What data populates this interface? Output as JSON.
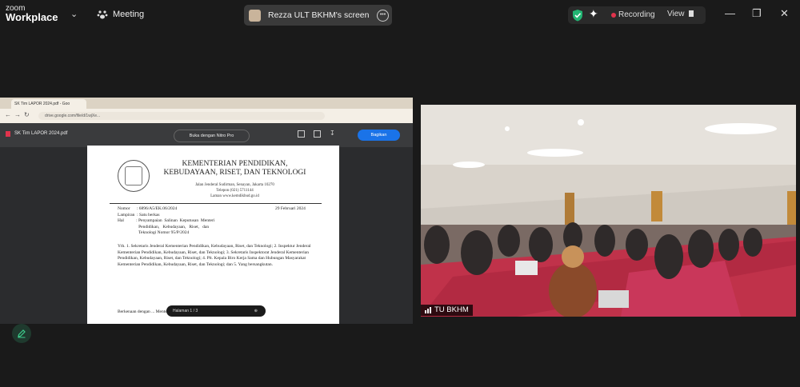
{
  "topbar": {
    "logo_line1": "zoom",
    "logo_line2": "Workplace",
    "meeting_label": "Meeting",
    "screen_share_label": "Rezza ULT BKHM's screen",
    "recording_label": "Recording",
    "view_label": "View"
  },
  "shared_screen": {
    "browser_tab": "SK Tim LAPOR 2024.pdf - Goo",
    "address": "drive.google.com/file/d/1wjXe...",
    "pdf_filename": "SK Tim LAPOR 2024.pdf",
    "open_with_label": "Buka dengan Nitro Pro",
    "share_label": "Bagikan",
    "page_indicator": "Halaman  1  /  3",
    "document": {
      "ministry_title": "KEMENTERIAN PENDIDIKAN, KEBUDAYAAN, RISET, DAN TEKNOLOGI",
      "address_line1": "Jalan Jenderal Sudirman, Senayan, Jakarta 10270",
      "address_line2": "Telepon (021) 5711144",
      "address_line3": "Laman www.kemdikbud.go.id",
      "meta": "Nomor      : 6896/A5/EK.06/2024\nLampiran  : Satu berkas\nHal           : Penyampaian  Salinan  Keputusan  Menteri\n                   Pendidikan,   Kebudayaan,   Riset,   dan\n                   Teknologi Nomor 95/P/2024",
      "date": "29 Februari 2024",
      "recipients": "Yth. 1. Sekretaris Jenderal Kementerian Pendidikan, Kebudayaan, Riset, dan Teknologi; 2. Inspektur Jenderal Kementerian Pendidikan, Kebudayaan, Riset, dan Teknologi; 3. Sekretaris Inspektorat Jenderal Kementerian Pendidikan, Kebudayaan, Riset, dan Teknologi; 4. Plt. Kepala Biro Kerja Sama dan Hubungan Masyarakat Kementerian Pendidikan, Kebudayaan, Riset, dan Teknologi; dan 5. Yang bersangkutan.",
      "closing": "Berkenaan dengan ... Menteri Pendidikan, Kebudayaan, Riset, ... Tim Pengelola"
    }
  },
  "video": {
    "participant_name": "TU BKHM"
  },
  "colors": {
    "background": "#1a1a1a",
    "recording_dot": "#e0334c",
    "share_button": "#1a73e8",
    "edit_icon": "#3ecf8e"
  }
}
